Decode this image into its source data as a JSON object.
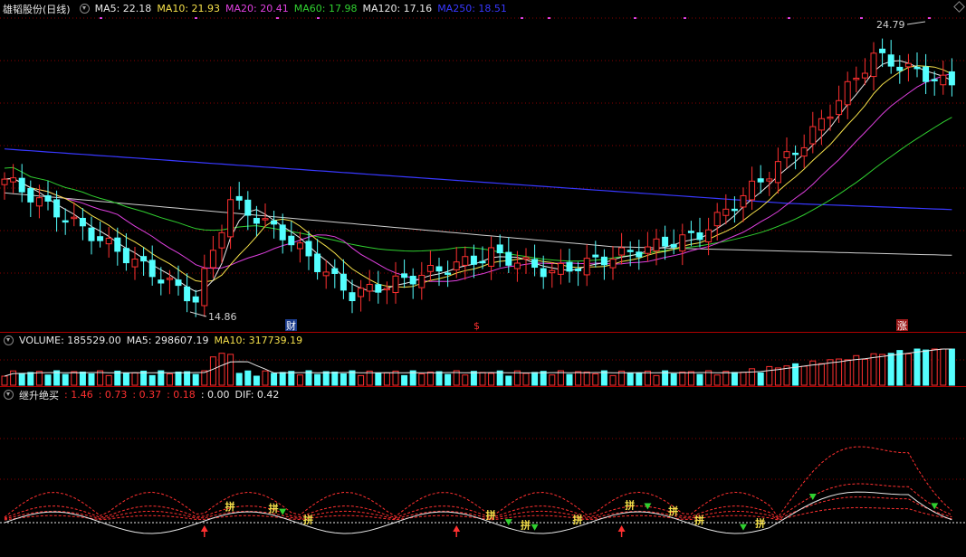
{
  "main_panel": {
    "stock_title": "雄韬股份(日线)",
    "ma_labels": [
      {
        "text": "MA5: 22.18",
        "color": "#e8e8e8"
      },
      {
        "text": "MA10: 21.93",
        "color": "#f5e04a"
      },
      {
        "text": "MA20: 20.41",
        "color": "#e040e0"
      },
      {
        "text": "MA60: 17.98",
        "color": "#30d030"
      },
      {
        "text": "MA120: 17.16",
        "color": "#e8e8e8"
      },
      {
        "text": "MA250: 18.51",
        "color": "#3838ff"
      }
    ],
    "high_label": "24.79",
    "low_label": "14.86",
    "event_markers": [
      {
        "text": "财",
        "color": "#ffffff",
        "bg": "#1a3a8a"
      },
      {
        "text": "$",
        "color": "#ff3030",
        "bg": "#000000"
      },
      {
        "text": "涨",
        "color": "#ffffff",
        "bg": "#9a1a1a"
      }
    ]
  },
  "volume_panel": {
    "labels": [
      {
        "text": "VOLUME: 185529.00",
        "color": "#e8e8e8"
      },
      {
        "text": "MA5: 298607.19",
        "color": "#e8e8e8"
      },
      {
        "text": "MA10: 317739.19",
        "color": "#f5e04a"
      }
    ]
  },
  "indicator_panel": {
    "title": "继升绝买",
    "labels": [
      {
        "text": ": 1.46",
        "color": "#ff3030"
      },
      {
        "text": ": 0.73",
        "color": "#ff3030"
      },
      {
        "text": ": 0.37",
        "color": "#ff3030"
      },
      {
        "text": ": 0.18",
        "color": "#ff3030"
      },
      {
        "text": ": 0.00",
        "color": "#e8e8e8"
      },
      {
        "text": "DIF: 0.42",
        "color": "#e8e8e8"
      }
    ],
    "signal_text": "拼"
  },
  "colors": {
    "up": "#ff3030",
    "down": "#54ffff",
    "grid": "#8a0000",
    "ma5": "#e8e8e8",
    "ma10": "#f5e04a",
    "ma20": "#e040e0",
    "ma60": "#30d030",
    "ma120": "#cfcfcf",
    "ma250": "#3838ff"
  }
}
